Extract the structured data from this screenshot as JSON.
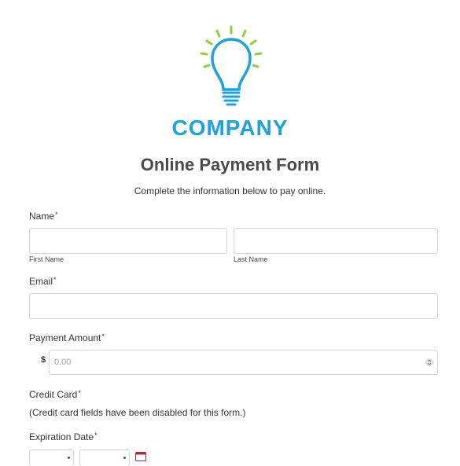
{
  "brand": {
    "logo_icon": "lightbulb-icon",
    "name": "COMPANY",
    "accent_color": "#1aa3dd",
    "ray_color": "#8bd13a"
  },
  "form": {
    "title": "Online Payment Form",
    "subtitle": "Complete the information below to pay online.",
    "name": {
      "label": "Name",
      "required_mark": "*",
      "first_sublabel": "First Name",
      "last_sublabel": "Last Name",
      "first_value": "",
      "last_value": ""
    },
    "email": {
      "label": "Email",
      "required_mark": "*",
      "value": ""
    },
    "amount": {
      "label": "Payment Amount",
      "required_mark": "*",
      "currency_symbol": "$",
      "placeholder": "0.00"
    },
    "credit_card": {
      "label": "Credit Card",
      "required_mark": "*",
      "note": "(Credit card fields have been disabled for this form.)"
    },
    "expiration": {
      "label": "Expiration Date",
      "required_mark": "*",
      "calendar_icon": "calendar-icon"
    }
  }
}
